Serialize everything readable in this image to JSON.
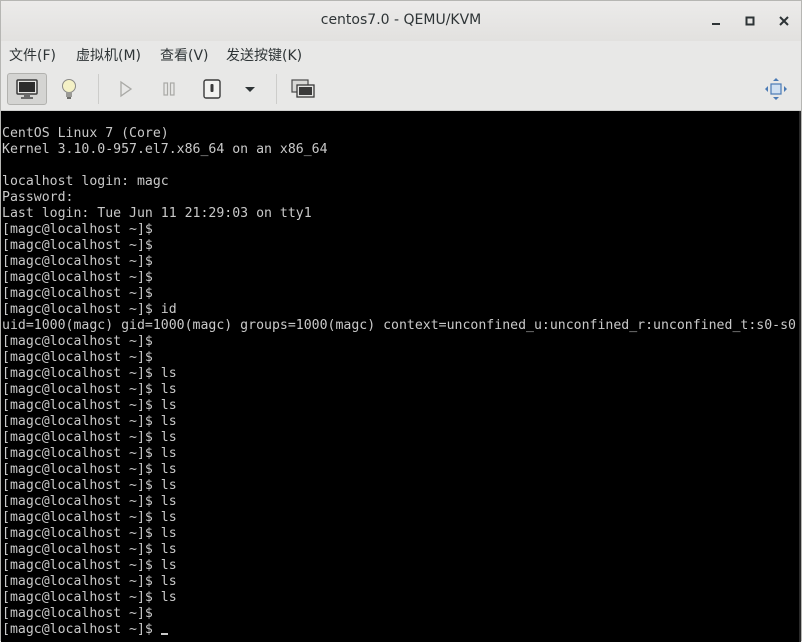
{
  "window": {
    "title": "centos7.0 - QEMU/KVM"
  },
  "menubar": {
    "items": [
      "文件(F)",
      "虚拟机(M)",
      "查看(V)",
      "发送按键(K)"
    ]
  },
  "toolbar": {
    "buttons": [
      {
        "icon": "console-icon",
        "active": true
      },
      {
        "icon": "lightbulb-icon"
      },
      {
        "icon": "play-icon"
      },
      {
        "icon": "pause-icon"
      },
      {
        "icon": "power-icon"
      },
      {
        "icon": "dropdown-icon"
      },
      {
        "icon": "snapshot-icon"
      },
      {
        "icon": "fullscreen-icon"
      }
    ]
  },
  "console": {
    "lines": [
      "CentOS Linux 7 (Core)",
      "Kernel 3.10.0-957.el7.x86_64 on an x86_64",
      "",
      "localhost login: magc",
      "Password:",
      "Last login: Tue Jun 11 21:29:03 on tty1",
      "[magc@localhost ~]$",
      "[magc@localhost ~]$",
      "[magc@localhost ~]$",
      "[magc@localhost ~]$",
      "[magc@localhost ~]$",
      "[magc@localhost ~]$ id",
      "uid=1000(magc) gid=1000(magc) groups=1000(magc) context=unconfined_u:unconfined_r:unconfined_t:s0-s0",
      "[magc@localhost ~]$",
      "[magc@localhost ~]$",
      "[magc@localhost ~]$ ls",
      "[magc@localhost ~]$ ls",
      "[magc@localhost ~]$ ls",
      "[magc@localhost ~]$ ls",
      "[magc@localhost ~]$ ls",
      "[magc@localhost ~]$ ls",
      "[magc@localhost ~]$ ls",
      "[magc@localhost ~]$ ls",
      "[magc@localhost ~]$ ls",
      "[magc@localhost ~]$ ls",
      "[magc@localhost ~]$ ls",
      "[magc@localhost ~]$ ls",
      "[magc@localhost ~]$ ls",
      "[magc@localhost ~]$ ls",
      "[magc@localhost ~]$ ls",
      "[magc@localhost ~]$",
      "[magc@localhost ~]$ "
    ]
  }
}
